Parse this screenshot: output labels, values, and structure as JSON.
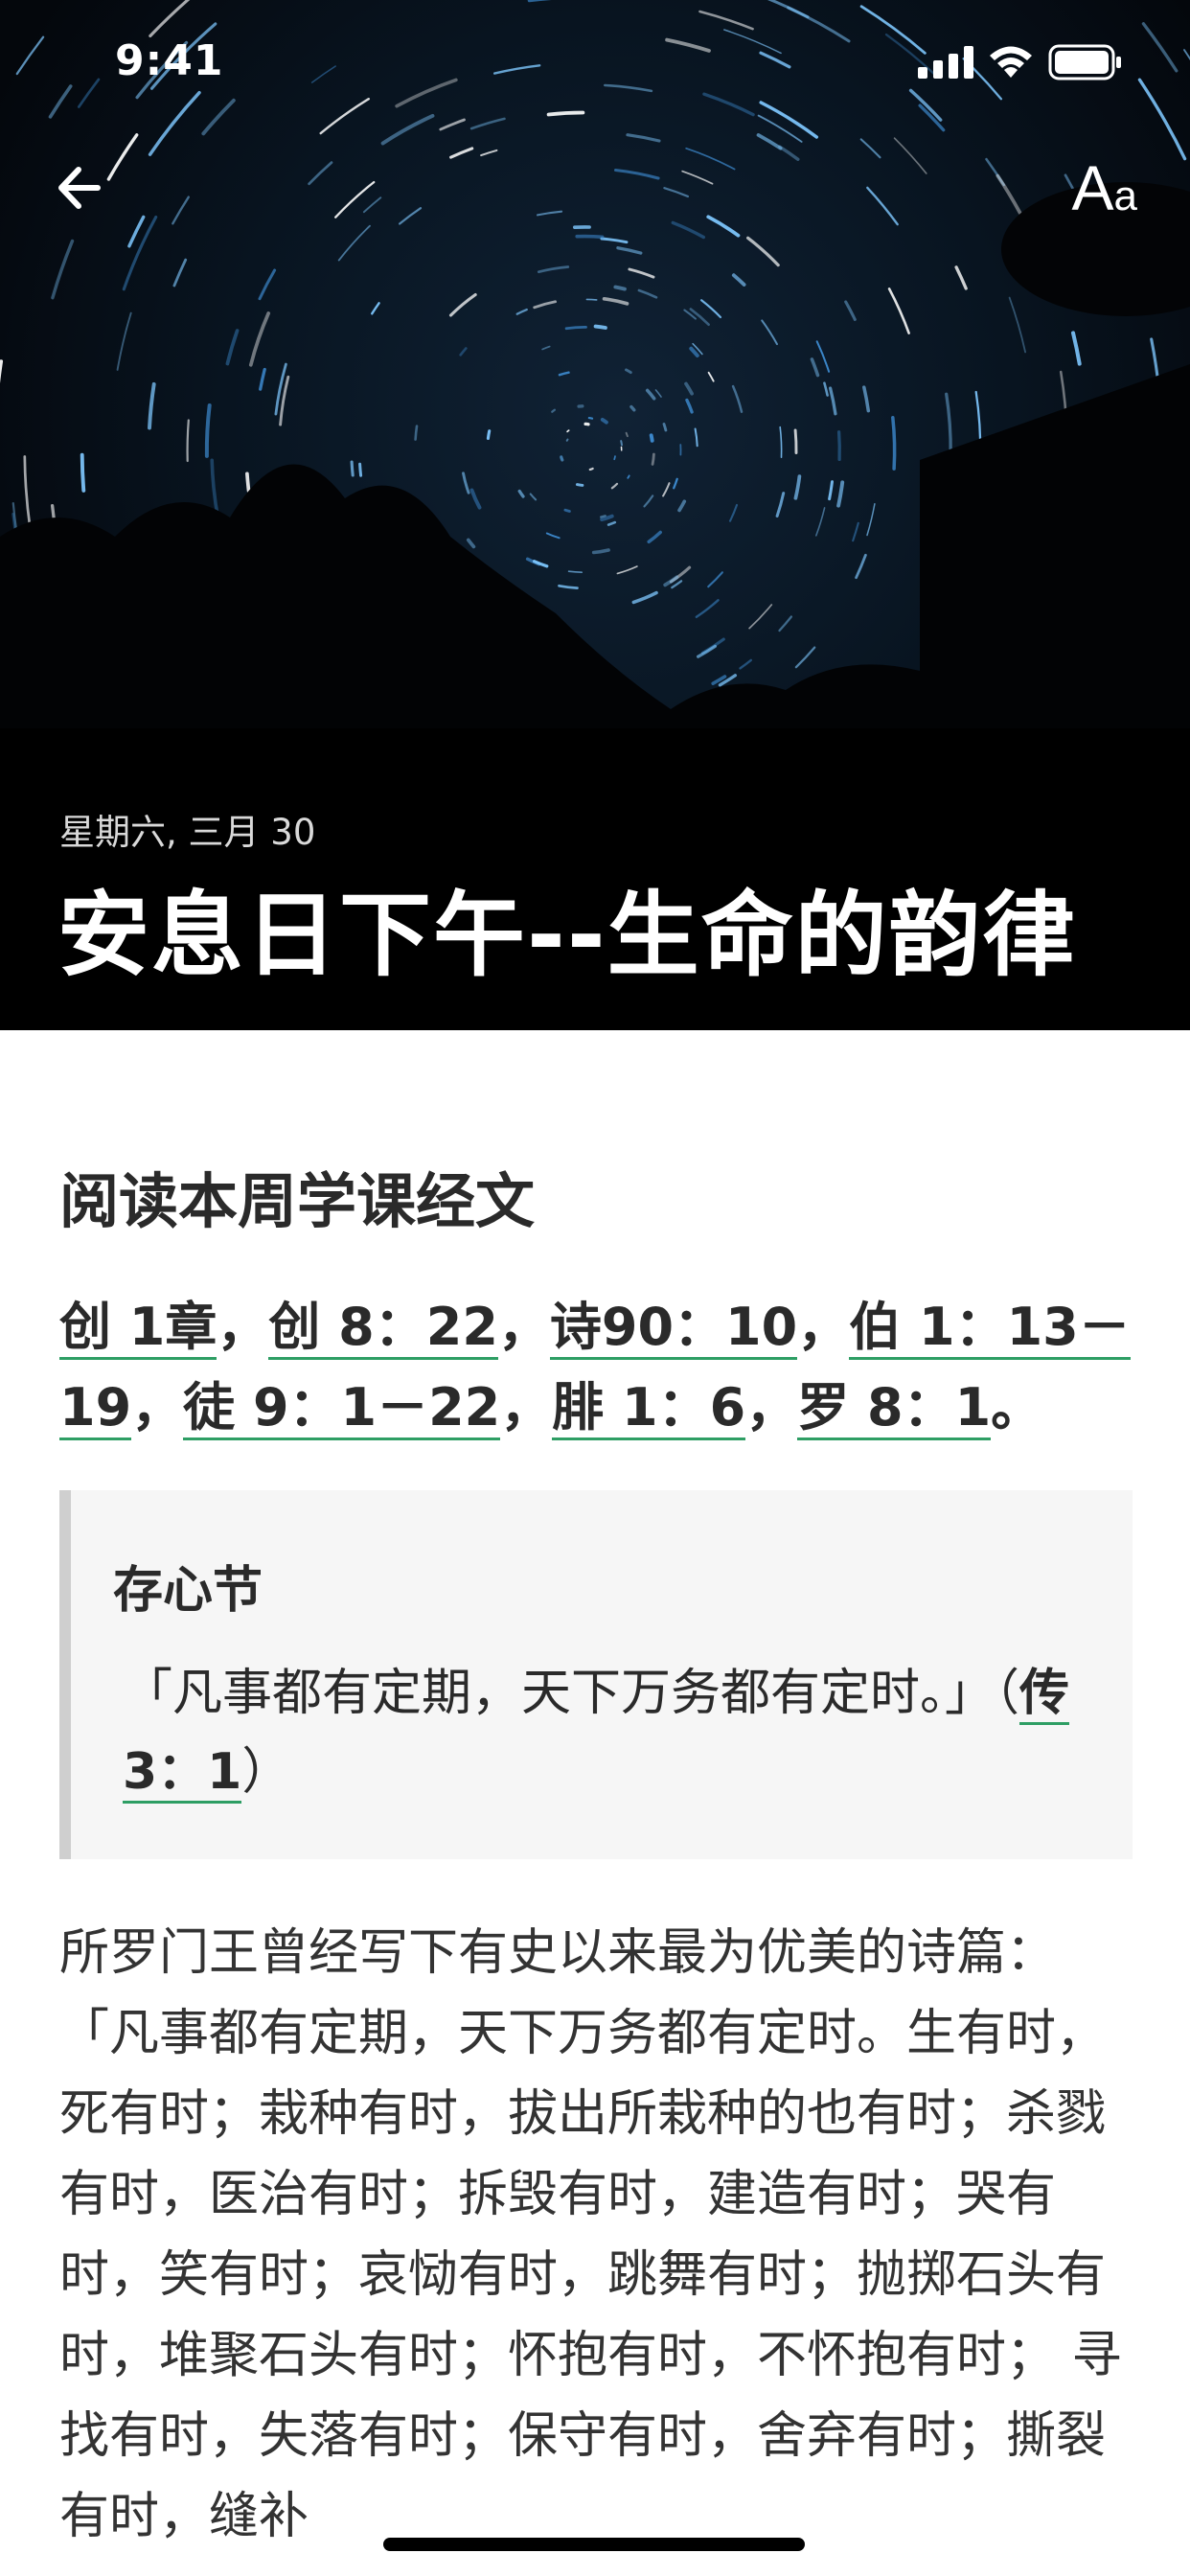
{
  "status_bar": {
    "time": "9:41"
  },
  "header": {
    "date": "星期六, 三月 30",
    "title": "安息日下午--生命的韵律",
    "font_button": {
      "big": "A",
      "small": "a"
    }
  },
  "content": {
    "section_heading": "阅读本周学课经文",
    "references": [
      "创 1章",
      "创 8：22",
      "诗90：10",
      "伯 1：13－19",
      "徒 9：1－22",
      "腓 1：6",
      "罗 8：1"
    ],
    "references_sep": "，",
    "references_end": "。",
    "memory_verse": {
      "label": "存心节",
      "text": "「凡事都有定期，天下万务都有定时。」（",
      "ref": "传3：1",
      "close": "）"
    },
    "body": "所罗门王曾经写下有史以来最为优美的诗篇：「凡事都有定期，天下万务都有定时。生有时，死有时；栽种有时，拔出所栽种的也有时；杀戮有时，医治有时；拆毁有时，建造有时；哭有时，笑有时；哀恸有时，跳舞有时；抛掷石头有时，堆聚石头有时；怀抱有时，不怀抱有时； 寻找有时，失落有时；保守有时，舍弃有时；撕裂有时，缝补"
  },
  "colors": {
    "link_underline": "#2e9e64",
    "text": "#2a2a2a",
    "memory_bg": "#f6f6f6",
    "memory_border": "#cfcfcf"
  },
  "icons": [
    "back-arrow-icon",
    "font-size-icon",
    "signal-icon",
    "wifi-icon",
    "battery-icon"
  ]
}
